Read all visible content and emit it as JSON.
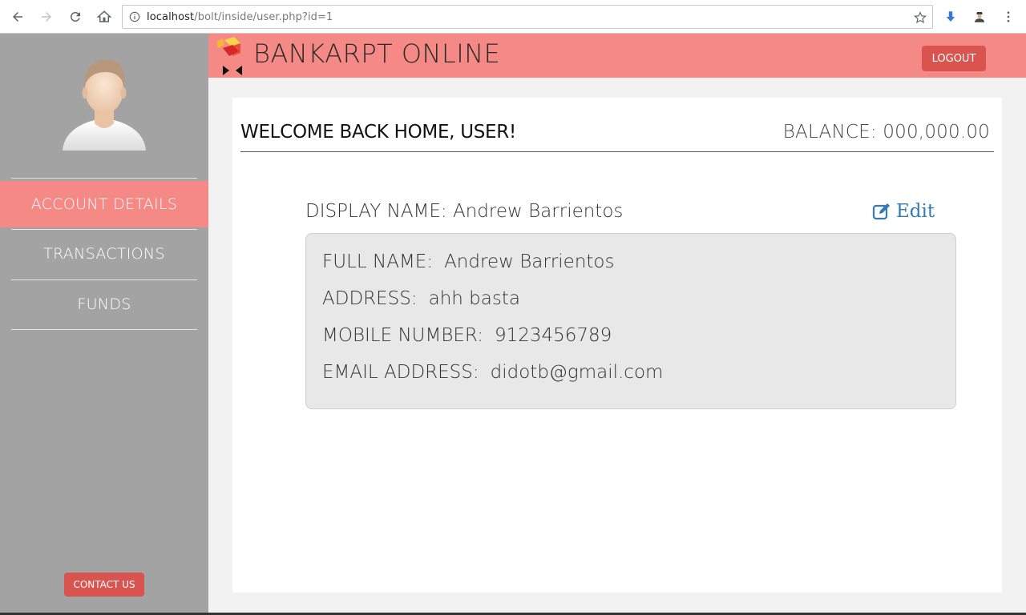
{
  "browser": {
    "url_host": "localhost",
    "url_path": "/bolt/inside/user.php?id=1"
  },
  "header": {
    "brand": "BANKARPT ONLINE",
    "logout_label": "LOGOUT"
  },
  "sidebar": {
    "items": [
      {
        "label": "ACCOUNT DETAILS",
        "active": true
      },
      {
        "label": "TRANSACTIONS",
        "active": false
      },
      {
        "label": "FUNDS",
        "active": false
      }
    ],
    "contact_label": "CONTACT US"
  },
  "main": {
    "welcome": "WELCOME BACK HOME, USER!",
    "balance": "BALANCE: 000,000.00",
    "display_name": "DISPLAY NAME: Andrew Barrientos",
    "edit_label": "Edit",
    "details": [
      {
        "label": "FULL NAME:",
        "value": "Andrew Barrientos"
      },
      {
        "label": "ADDRESS:",
        "value": "ahh basta"
      },
      {
        "label": "MOBILE NUMBER:",
        "value": "9123456789"
      },
      {
        "label": "EMAIL ADDRESS:",
        "value": "didotb@gmail.com"
      }
    ]
  },
  "colors": {
    "accent": "#f48985",
    "button_red": "#d9534f",
    "sidebar_bg": "#a3a3a3",
    "link_blue": "#337ab7"
  }
}
